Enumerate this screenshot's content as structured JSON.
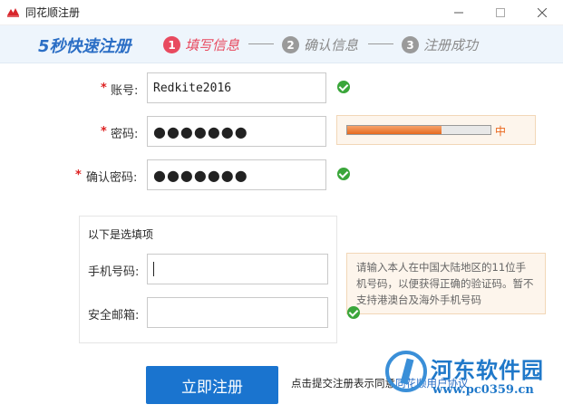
{
  "window": {
    "title": "同花顺注册"
  },
  "steps": {
    "brand": "5秒快速注册",
    "items": [
      {
        "num": "1",
        "label": "填写信息"
      },
      {
        "num": "2",
        "label": "确认信息"
      },
      {
        "num": "3",
        "label": "注册成功"
      }
    ]
  },
  "form": {
    "required_mark": "*",
    "account": {
      "label": "账号:",
      "value": "Redkite2016"
    },
    "password": {
      "label": "密码:",
      "value": "●●●●●●●"
    },
    "confirm": {
      "label": "确认密码:",
      "value": "●●●●●●●"
    },
    "strength": {
      "label": "中",
      "level": 0.66
    }
  },
  "optional": {
    "title": "以下是选填项",
    "phone": {
      "label": "手机号码:",
      "value": ""
    },
    "email": {
      "label": "安全邮箱:",
      "value": ""
    }
  },
  "tip": {
    "text": "请输入本人在中国大陆地区的11位手机号码，以便获得正确的验证码。暂不支持港澳台及海外手机号码"
  },
  "actions": {
    "register_label": "立即注册",
    "agree_prefix": "点击提交注册表示同意",
    "agree_link": "同花顺用户协议"
  },
  "watermark": {
    "name": "河东软件园",
    "url": "www.pc0359.cn"
  },
  "colors": {
    "accent": "#1a74cf",
    "step_active": "#e84a5f",
    "ok": "#3aa63a",
    "strength": "#e66a1f"
  }
}
